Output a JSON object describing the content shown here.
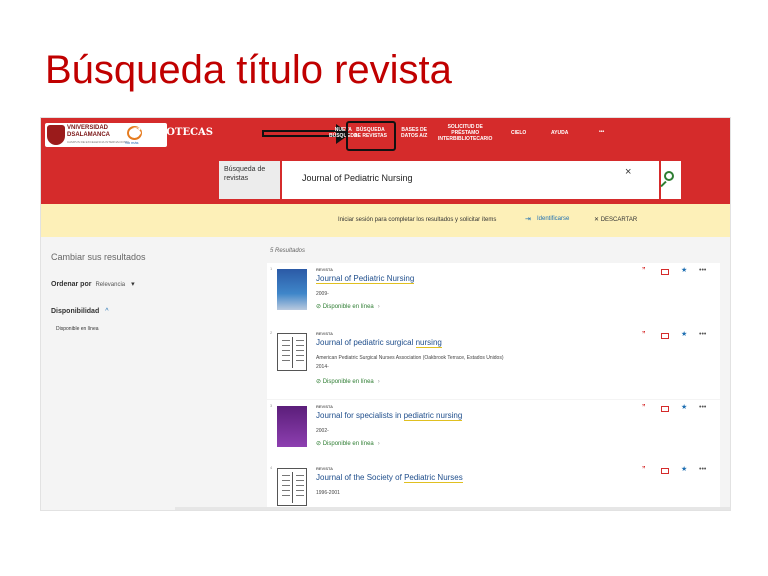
{
  "slide": {
    "title": "Búsqueda título revista"
  },
  "header": {
    "university_lines": [
      "VNIVERSIDAD",
      "DSALAMANCA"
    ],
    "university_sub": "CAMPUS DE EXCELENCIA INTERNACIONAL",
    "swirl_text": "Su más",
    "brand": "BIBLIOTECAS",
    "nav": [
      {
        "label": "NUEVA\nBÚSQUEDA"
      },
      {
        "label": "BÚSQUEDA\nDE REVISTAS"
      },
      {
        "label": "BASES DE\nDATOS A/Z"
      },
      {
        "label": "SOLICITUD DE\nPRÉSTAMO\nINTERBIBLIOTECARIO"
      },
      {
        "label": "CIELO"
      },
      {
        "label": "AYUDA"
      },
      {
        "label": "•••"
      }
    ]
  },
  "search": {
    "label": "Búsqueda de revistas",
    "value": "Journal of Pediatric Nursing",
    "clear_icon": "×"
  },
  "login_bar": {
    "message": "Iniciar sesión para completar los resultados y solicitar ítems",
    "login_link": "Identificarse",
    "dismiss": "DESCARTAR"
  },
  "sidebar": {
    "title": "Cambiar sus resultados",
    "sort_label": "Ordenar por",
    "sort_value": "Relevancia",
    "availability_label": "Disponibilidad",
    "availability_option": "Disponible en línea"
  },
  "results": {
    "count_text": "5 Resultados",
    "items": [
      {
        "index": "1",
        "type": "REVISTA",
        "title_pre": "",
        "title_hl": "Journal of Pediatric Nursing",
        "title_post": "",
        "line1": "2009-",
        "line2": "",
        "availability": "Disponible en línea",
        "cover": "blue"
      },
      {
        "index": "2",
        "type": "REVISTA",
        "title_pre": "Journal of pediatric surgical ",
        "title_hl": "nursing",
        "title_post": "",
        "line1": "American Pediatric Surgical Nurses Association (Oakbrook Terrace, Estados Unidos)",
        "line2": "2014-",
        "availability": "Disponible en línea",
        "cover": "book"
      },
      {
        "index": "3",
        "type": "REVISTA",
        "title_pre": "Journal for specialists in ",
        "title_hl": "pediatric nursing",
        "title_post": "",
        "line1": "2002-",
        "line2": "",
        "availability": "Disponible en línea",
        "cover": "purple"
      },
      {
        "index": "4",
        "type": "REVISTA",
        "title_pre": "Journal of the Society of ",
        "title_hl": "Pediatric Nurses",
        "title_post": "",
        "line1": "1996-2001",
        "line2": "",
        "availability": "",
        "cover": "book"
      }
    ]
  },
  "actions": {
    "cite": "”",
    "pin": "★",
    "more": "•••"
  },
  "colors": {
    "primary": "#d52b2b",
    "banner": "#fdf0b8",
    "link": "#1f4e8c",
    "available": "#2e7d32"
  }
}
